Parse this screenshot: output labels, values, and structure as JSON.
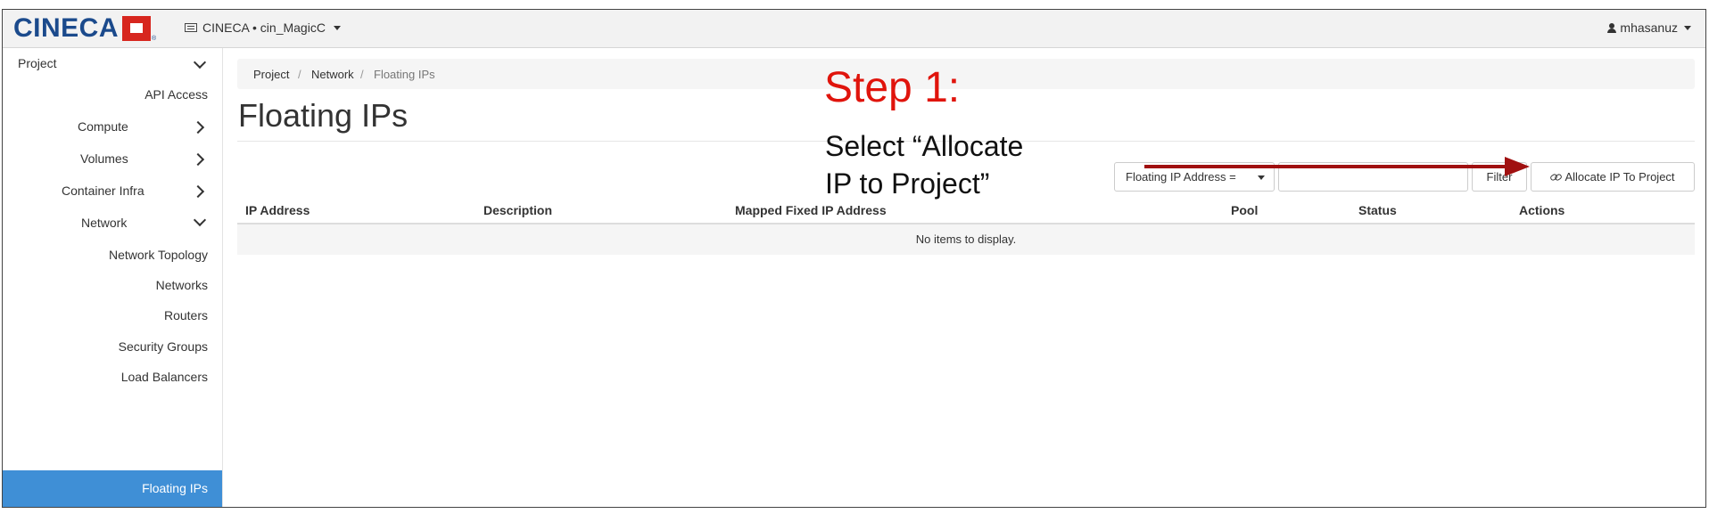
{
  "topbar": {
    "logo_text": "CINECA",
    "project_label": "CINECA • cin_MagicC",
    "user_label": "mhasanuz"
  },
  "sidebar": {
    "items": [
      {
        "label": "Project",
        "chevron": "down"
      },
      {
        "label": "API Access"
      },
      {
        "label": "Compute",
        "chevron": "right"
      },
      {
        "label": "Volumes",
        "chevron": "right"
      },
      {
        "label": "Container Infra",
        "chevron": "right"
      },
      {
        "label": "Network",
        "chevron": "down"
      },
      {
        "label": "Network Topology"
      },
      {
        "label": "Networks"
      },
      {
        "label": "Routers"
      },
      {
        "label": "Security Groups"
      },
      {
        "label": "Load Balancers"
      },
      {
        "label": "Floating IPs",
        "active": true
      }
    ]
  },
  "breadcrumb": {
    "items": [
      "Project",
      "Network",
      "Floating IPs"
    ],
    "separator": "/"
  },
  "page": {
    "title": "Floating IPs"
  },
  "filter": {
    "select_label": "Floating IP Address =",
    "input_value": "",
    "button_label": "Filter"
  },
  "actions": {
    "allocate_label": "Allocate IP To Project"
  },
  "table": {
    "headers": [
      "IP Address",
      "Description",
      "Mapped Fixed IP Address",
      "Pool",
      "Status",
      "Actions"
    ],
    "empty_message": "No items to display."
  },
  "annotation": {
    "step": "Step 1:",
    "line1": "Select “Allocate",
    "line2": "IP to Project”",
    "arrow_color": "#a01010"
  },
  "colors": {
    "accent": "#3f8fd6",
    "logo_blue": "#1b4a8c",
    "logo_red": "#d7261e",
    "annotation_red": "#e0140c"
  }
}
